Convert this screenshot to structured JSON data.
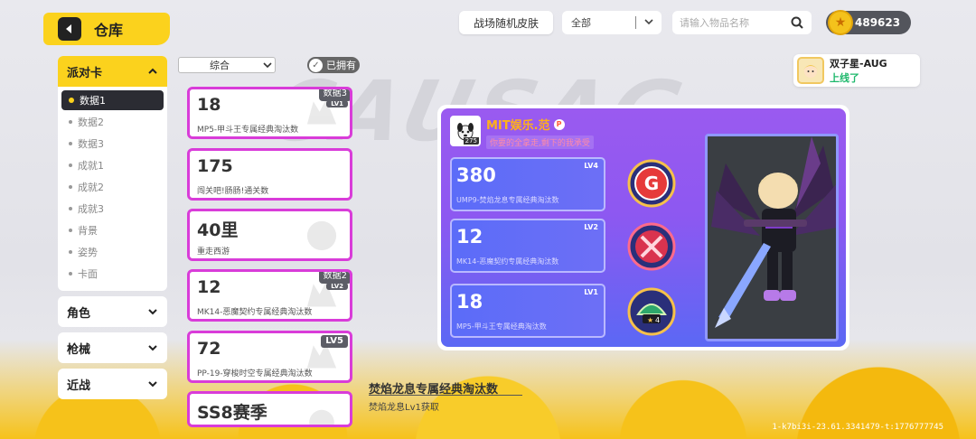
{
  "header": {
    "title": "仓库",
    "back_icon": "back-arrow-icon",
    "random_skin_label": "战场随机皮肤",
    "filter_value": "全部",
    "search_placeholder": "请输入物品名称",
    "currency_amount": "489623",
    "currency_icon": "star-coin-icon"
  },
  "online_notice": {
    "name": "双子星-AUG",
    "status": "上线了"
  },
  "sidebar": {
    "open_category": "派对卡",
    "sub_items": [
      {
        "label": "数据1",
        "active": true
      },
      {
        "label": "数据2",
        "active": false
      },
      {
        "label": "数据3",
        "active": false
      },
      {
        "label": "成就1",
        "active": false
      },
      {
        "label": "成就2",
        "active": false
      },
      {
        "label": "成就3",
        "active": false
      },
      {
        "label": "背景",
        "active": false
      },
      {
        "label": "姿势",
        "active": false
      },
      {
        "label": "卡面",
        "active": false
      }
    ],
    "closed_categories": [
      "角色",
      "枪械",
      "近战"
    ]
  },
  "list": {
    "sort_value": "综合",
    "owned_label": "已拥有",
    "cards": [
      {
        "value": "18",
        "desc": "MP5-甲斗王专属经典淘汰数",
        "tag": "数据3",
        "lv": "LV1"
      },
      {
        "value": "175",
        "desc": "闯关吧!肠肠!通关数",
        "tag": "",
        "lv": ""
      },
      {
        "value": "40里",
        "desc": "重走西游",
        "tag": "",
        "lv": ""
      },
      {
        "value": "12",
        "desc": "MK14-恶魔契约专属经典淘汰数",
        "tag": "数据2",
        "lv": "LV2"
      },
      {
        "value": "72",
        "desc": "PP-19-穿梭时空专属经典淘汰数",
        "tag": "",
        "lv": "LV5"
      },
      {
        "value": "SS8赛季",
        "desc": "",
        "tag": "",
        "lv": ""
      }
    ]
  },
  "detail": {
    "player_name": "MIT娱乐.范",
    "player_level": "275",
    "player_sign": "你要的全拿走,剩下的我承受",
    "stats": [
      {
        "value": "380",
        "desc": "UMP9-焚焰龙息专属经典淘汰数",
        "lv": "LV4"
      },
      {
        "value": "12",
        "desc": "MK14-恶魔契约专属经典淘汰数",
        "lv": "LV2"
      },
      {
        "value": "18",
        "desc": "MP5-甲斗王专属经典淘汰数",
        "lv": "LV1"
      }
    ],
    "medal_count": "4"
  },
  "footer": {
    "item_name": "焚焰龙息专属经典淘汰数",
    "source": "焚焰龙息Lv1获取",
    "version": "1-k7bi3i-23.61.3341479-t:1776777745"
  },
  "colors": {
    "accent_yellow": "#fbd21d",
    "card_border": "#d93cd9",
    "panel_purple": "#9a5af0",
    "online_green": "#1db86b"
  }
}
